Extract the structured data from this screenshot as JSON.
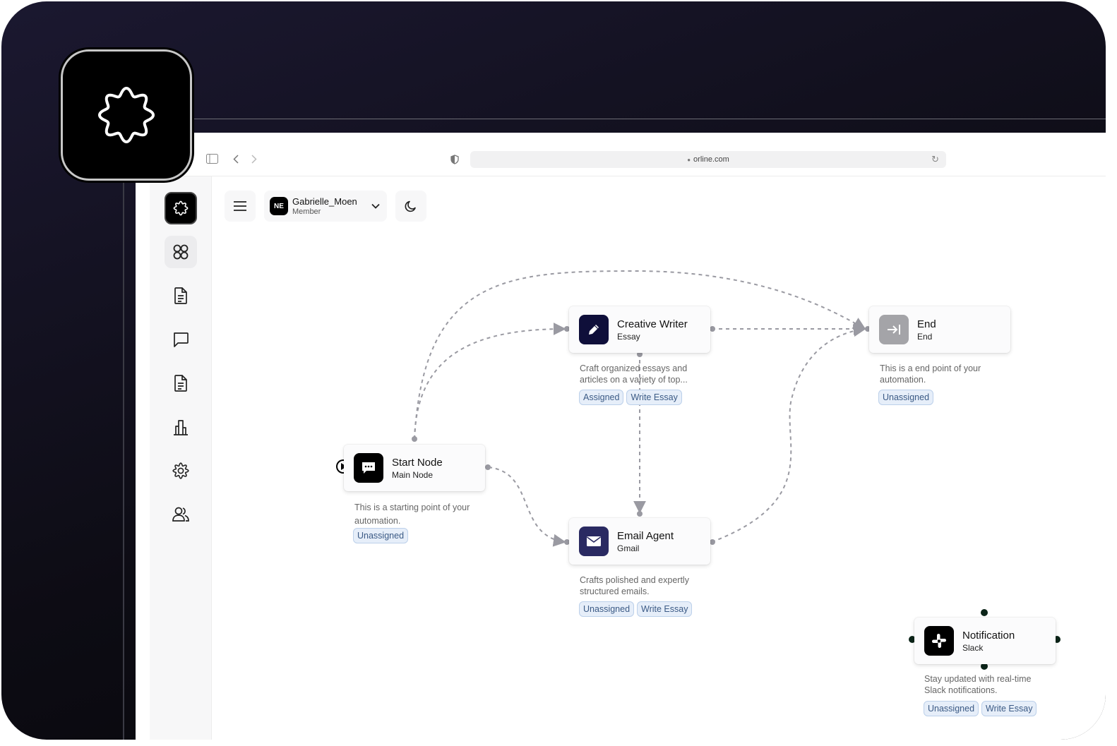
{
  "browser": {
    "url": "orline.com"
  },
  "user": {
    "initials": "NE",
    "name": "Gabrielle_Moen",
    "role": "Member"
  },
  "nodes": [
    {
      "title": "Creative Writer",
      "subtitle": "Essay",
      "description": "Craft organized essays and articles on a variety of top...",
      "tags": [
        "Assigned",
        "Write Essay"
      ]
    },
    {
      "title": "End",
      "subtitle": "End",
      "description": "This is a end point of your automation.",
      "tags": [
        "Unassigned"
      ]
    },
    {
      "title": "Start Node",
      "subtitle": "Main Node",
      "description": "This is a starting point of your automation.",
      "tags": [
        "Unassigned"
      ]
    },
    {
      "title": "Email Agent",
      "subtitle": "Gmail",
      "description": "Crafts polished and expertly structured emails.",
      "tags": [
        "Unassigned",
        "Write Essay"
      ]
    },
    {
      "title": "Notification",
      "subtitle": "Slack",
      "description": "Stay updated with real-time Slack notifications.",
      "tags": [
        "Unassigned",
        "Write Essay"
      ]
    }
  ],
  "colors": {
    "creative": "#0f0f3a",
    "end": "#a4a4a8",
    "start": "#000000",
    "email": "#2a2a62",
    "notification": "#000000"
  }
}
